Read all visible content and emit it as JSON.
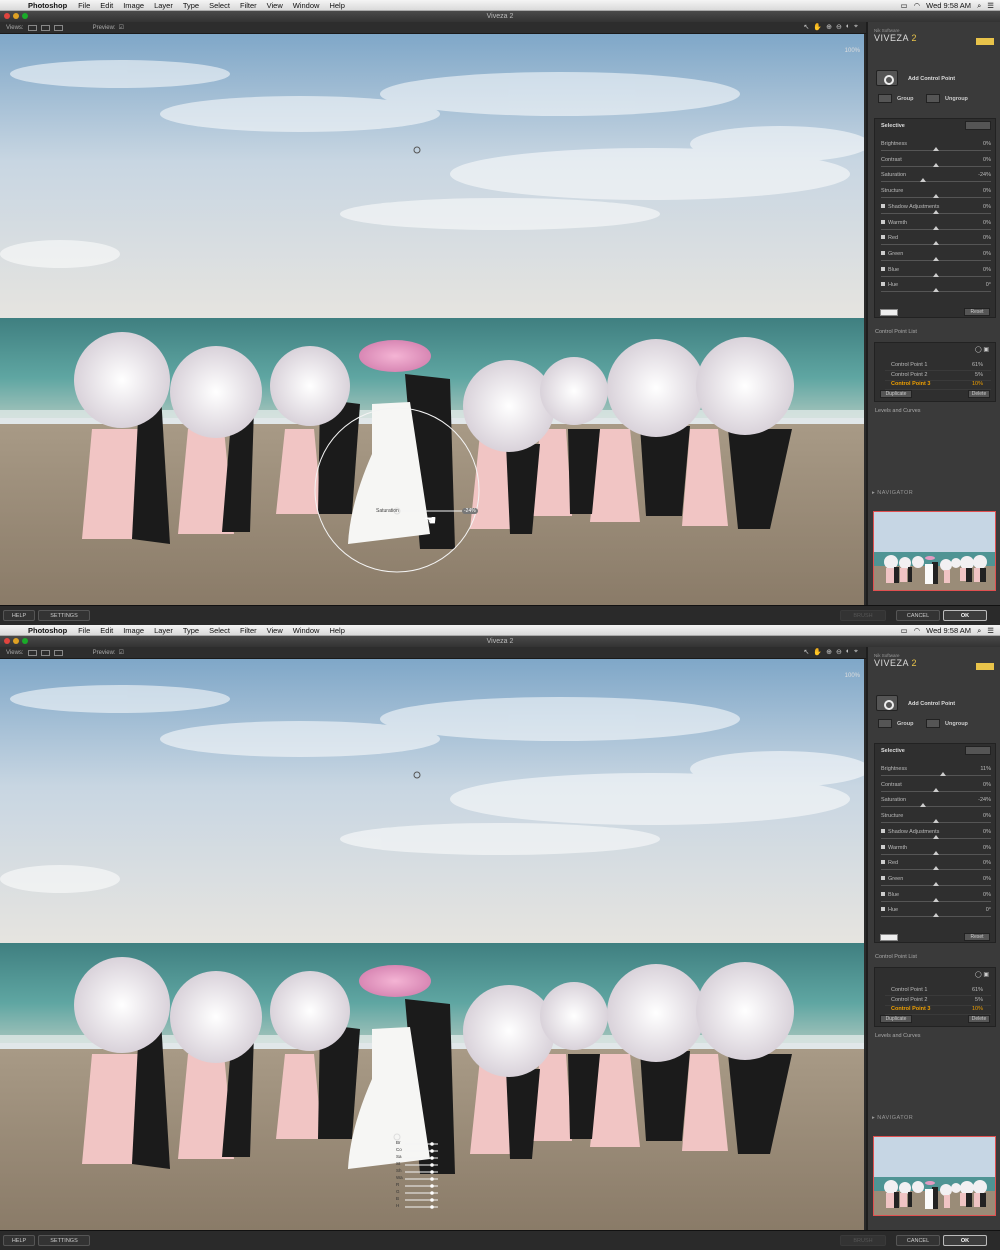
{
  "menubar": {
    "app": "Photoshop",
    "items": [
      "File",
      "Edit",
      "Image",
      "Layer",
      "Type",
      "Select",
      "Filter",
      "View",
      "Window",
      "Help"
    ],
    "clock": "Wed 9:58 AM"
  },
  "window": {
    "title": "Viveza 2"
  },
  "toolbar": {
    "views_label": "Views:",
    "preview_label": "Preview:"
  },
  "zoom": "100%",
  "panel": {
    "brand_sub": "Nik Software",
    "brand_name": "VIVEZA",
    "brand_num": "2",
    "add_cp": "Add Control Point",
    "group": "Group",
    "ungroup": "Ungroup",
    "selective": "Selective",
    "reset": "Reset",
    "cpl_title": "Control Point List",
    "duplicate": "Duplicate",
    "delete": "Delete",
    "levels": "Levels and Curves",
    "navigator": "▸ NAVIGATOR"
  },
  "frames": [
    {
      "sliders": [
        {
          "name": "Brightness",
          "value": "0%",
          "pos": 0.5,
          "check": false
        },
        {
          "name": "Contrast",
          "value": "0%",
          "pos": 0.5,
          "check": false
        },
        {
          "name": "Saturation",
          "value": "-24%",
          "pos": 0.38,
          "check": false
        },
        {
          "name": "Structure",
          "value": "0%",
          "pos": 0.5,
          "check": false
        },
        {
          "name": "Shadow Adjustments",
          "value": "0%",
          "pos": 0.5,
          "check": true
        },
        {
          "name": "Warmth",
          "value": "0%",
          "pos": 0.5,
          "check": true
        },
        {
          "name": "Red",
          "value": "0%",
          "pos": 0.5,
          "check": true
        },
        {
          "name": "Green",
          "value": "0%",
          "pos": 0.5,
          "check": true
        },
        {
          "name": "Blue",
          "value": "0%",
          "pos": 0.5,
          "check": true
        },
        {
          "name": "Hue",
          "value": "0°",
          "pos": 0.5,
          "check": true
        }
      ],
      "points": [
        {
          "name": "Control Point 1",
          "value": "61%",
          "active": false
        },
        {
          "name": "Control Point 2",
          "value": "5%",
          "active": false
        },
        {
          "name": "Control Point 3",
          "value": "10%",
          "active": true
        }
      ],
      "overlay": {
        "label": "Saturation",
        "value": "-24%"
      }
    },
    {
      "sliders": [
        {
          "name": "Brightness",
          "value": "11%",
          "pos": 0.56,
          "check": false
        },
        {
          "name": "Contrast",
          "value": "0%",
          "pos": 0.5,
          "check": false
        },
        {
          "name": "Saturation",
          "value": "-24%",
          "pos": 0.38,
          "check": false
        },
        {
          "name": "Structure",
          "value": "0%",
          "pos": 0.5,
          "check": false
        },
        {
          "name": "Shadow Adjustments",
          "value": "0%",
          "pos": 0.5,
          "check": true
        },
        {
          "name": "Warmth",
          "value": "0%",
          "pos": 0.5,
          "check": true
        },
        {
          "name": "Red",
          "value": "0%",
          "pos": 0.5,
          "check": true
        },
        {
          "name": "Green",
          "value": "0%",
          "pos": 0.5,
          "check": true
        },
        {
          "name": "Blue",
          "value": "0%",
          "pos": 0.5,
          "check": true
        },
        {
          "name": "Hue",
          "value": "0°",
          "pos": 0.5,
          "check": true
        }
      ],
      "points": [
        {
          "name": "Control Point 1",
          "value": "61%",
          "active": false
        },
        {
          "name": "Control Point 2",
          "value": "5%",
          "active": false
        },
        {
          "name": "Control Point 3",
          "value": "10%",
          "active": true
        }
      ],
      "mini_labels": [
        "Br",
        "Co",
        "Sa",
        "St",
        "Sh",
        "Wa",
        "R",
        "G",
        "B",
        "H"
      ]
    }
  ],
  "bottom": {
    "help": "HELP",
    "settings": "SETTINGS",
    "brush": "BRUSH",
    "cancel": "CANCEL",
    "ok": "OK"
  },
  "colors": {
    "accent": "#e8c34a",
    "active_point": "#f0a000",
    "panel_bg": "#3a3a3a"
  }
}
